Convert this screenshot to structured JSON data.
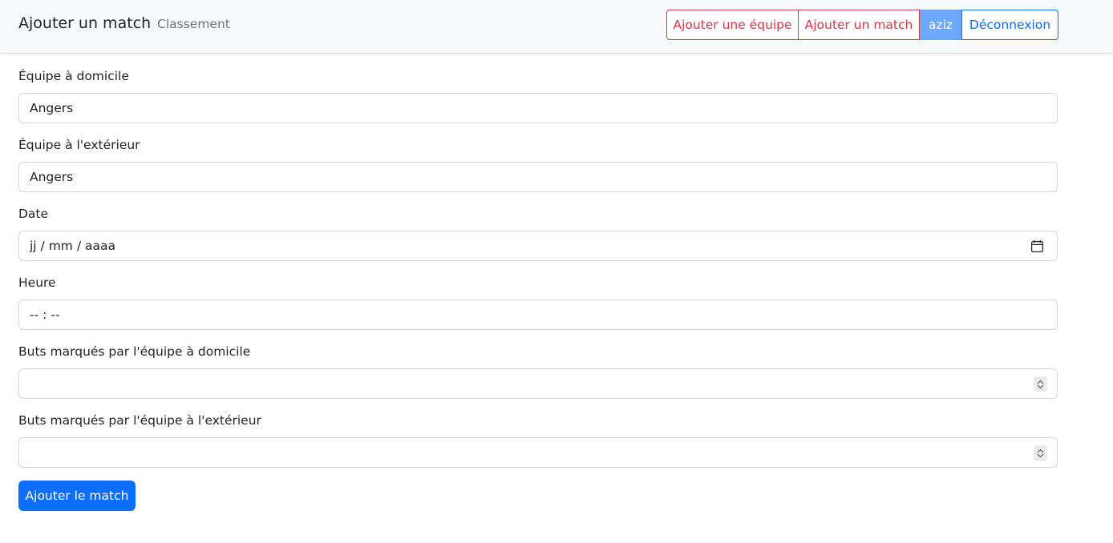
{
  "navbar": {
    "brand": "Ajouter un match",
    "link_classement": "Classement",
    "buttons": {
      "add_team": "Ajouter une équipe",
      "add_match": "Ajouter un match",
      "user": "aziz",
      "logout": "Déconnexion"
    }
  },
  "form": {
    "home_team": {
      "label": "Équipe à domicile",
      "value": "Angers"
    },
    "away_team": {
      "label": "Équipe à l'extérieur",
      "value": "Angers"
    },
    "date": {
      "label": "Date",
      "placeholder": "jj / mm / aaaa"
    },
    "time": {
      "label": "Heure",
      "placeholder": "-- : --"
    },
    "home_goals": {
      "label": "Buts marqués par l'équipe à domicile",
      "value": ""
    },
    "away_goals": {
      "label": "Buts marqués par l'équipe à l'extérieur",
      "value": ""
    },
    "submit_label": "Ajouter le match"
  },
  "colors": {
    "primary": "#0d6efd",
    "danger": "#dc3545",
    "user_badge": "#6ea8fe",
    "navbar_bg": "#f8f9fa"
  }
}
